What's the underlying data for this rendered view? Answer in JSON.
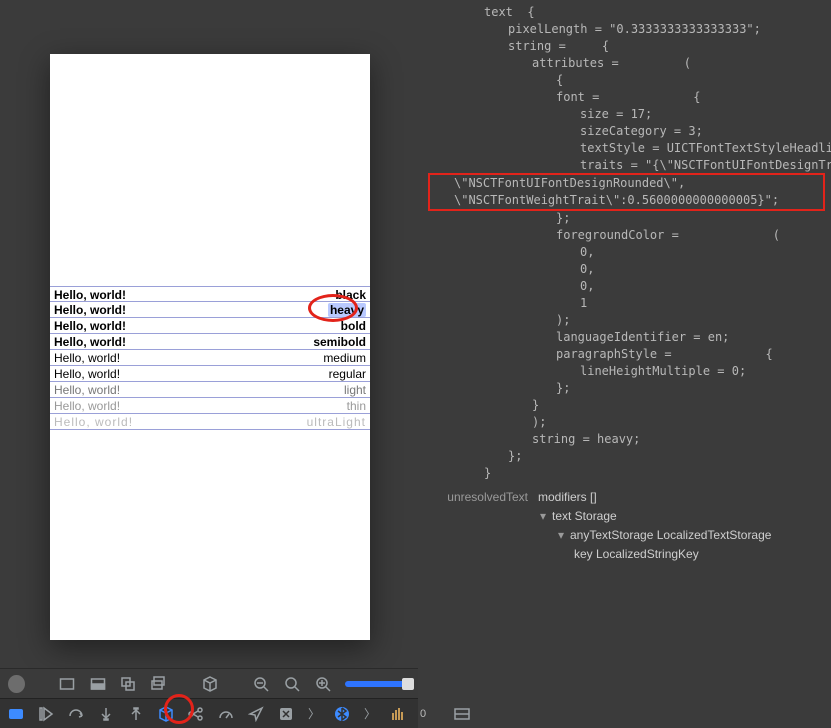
{
  "left": {
    "rows": [
      {
        "hello": "Hello, world!",
        "weight": "black",
        "cls": "w-black"
      },
      {
        "hello": "Hello, world!",
        "weight": "heavy",
        "cls": "w-heavy",
        "selected": true
      },
      {
        "hello": "Hello, world!",
        "weight": "bold",
        "cls": "w-bold"
      },
      {
        "hello": "Hello, world!",
        "weight": "semibold",
        "cls": "w-semibold"
      },
      {
        "hello": "Hello, world!",
        "weight": "medium",
        "cls": "w-medium"
      },
      {
        "hello": "Hello, world!",
        "weight": "regular",
        "cls": "w-regular"
      },
      {
        "hello": "Hello, world!",
        "weight": "light",
        "cls": "w-light"
      },
      {
        "hello": "Hello, world!",
        "weight": "thin",
        "cls": "w-thin"
      },
      {
        "hello": "Hello, world!",
        "weight": "ultraLight",
        "cls": "w-ultra"
      }
    ],
    "toolbar2_count": "0"
  },
  "inspector": {
    "lines": [
      {
        "cls": "i0",
        "t": "text  {"
      },
      {
        "cls": "i1",
        "t": "pixelLength = \"0.3333333333333333\";"
      },
      {
        "cls": "i1",
        "t": "string =     {"
      },
      {
        "cls": "i2",
        "t": "attributes =         ("
      },
      {
        "cls": "i3",
        "t": "{"
      },
      {
        "cls": "i3",
        "t": "font =             {"
      },
      {
        "cls": "i4",
        "t": "size = 17;"
      },
      {
        "cls": "i4",
        "t": "sizeCategory = 3;"
      },
      {
        "cls": "i4",
        "t": "textStyle = UICTFontTextStyleHeadline;"
      },
      {
        "cls": "i4",
        "t": "traits = \"{\\\"NSCTFontUIFontDesignTrait\\\":"
      },
      {
        "cls": "i4l hl",
        "t": "\\\"NSCTFontUIFontDesignRounded\\\",\n\\\"NSCTFontWeightTrait\\\":0.5600000000000005}\";"
      },
      {
        "cls": "i3",
        "t": "};"
      },
      {
        "cls": "i3",
        "t": "foregroundColor =             ("
      },
      {
        "cls": "i4",
        "t": "0,"
      },
      {
        "cls": "i4",
        "t": "0,"
      },
      {
        "cls": "i4",
        "t": "0,"
      },
      {
        "cls": "i4",
        "t": "1"
      },
      {
        "cls": "i3",
        "t": ");"
      },
      {
        "cls": "i3",
        "t": "languageIdentifier = en;"
      },
      {
        "cls": "i3",
        "t": "paragraphStyle =             {"
      },
      {
        "cls": "i4",
        "t": "lineHeightMultiple = 0;"
      },
      {
        "cls": "i3",
        "t": "};"
      },
      {
        "cls": "i2",
        "t": "}"
      },
      {
        "cls": "i2",
        "t": ");"
      },
      {
        "cls": "i2",
        "t": "string = heavy;"
      },
      {
        "cls": "i1",
        "t": "};"
      },
      {
        "cls": "i0",
        "t": "}"
      }
    ],
    "rows": [
      {
        "label": "unresolvedText",
        "value": "modifiers   []"
      },
      {
        "label": "",
        "value": "text   Storage",
        "disc": "v"
      },
      {
        "label": "",
        "value": "anyTextStorage   LocalizedTextStorage",
        "disc": "v",
        "indent": 1
      },
      {
        "label": "",
        "value": "key   LocalizedStringKey",
        "indent": 2
      }
    ]
  }
}
